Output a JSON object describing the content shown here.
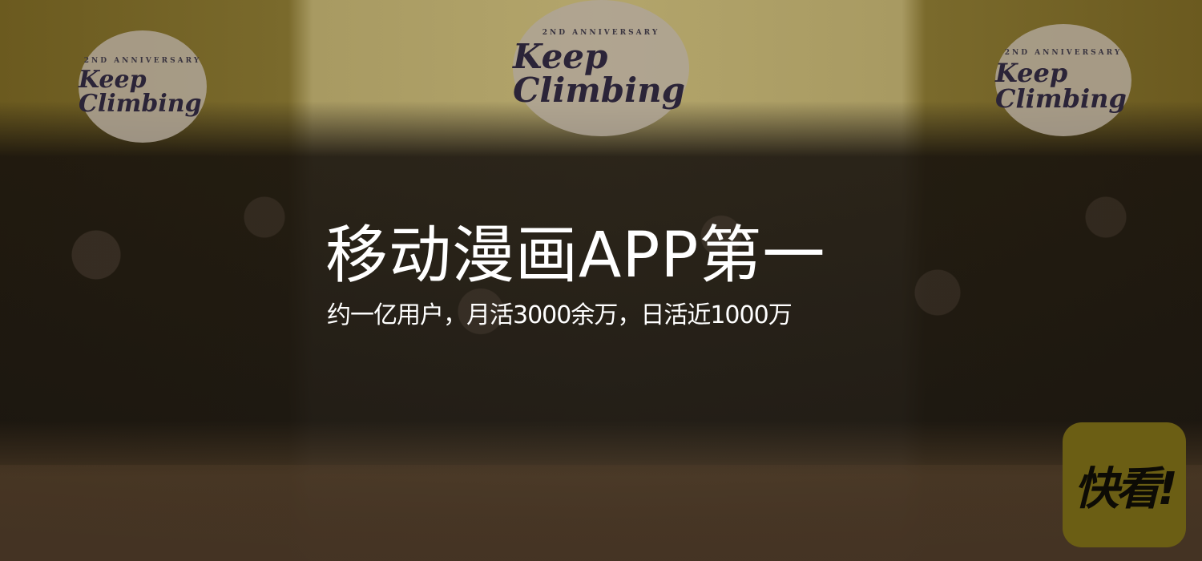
{
  "banner": {
    "title": "移动漫画APP第一",
    "subtitle": "约一亿用户，月活3000余万，日活近1000万"
  },
  "backdrop": {
    "logo_text": "Keep Climbing",
    "logo_sub": "2ND ANNIVERSARY"
  },
  "app_logo": {
    "text": "快看!",
    "color": "#6b5e14"
  }
}
